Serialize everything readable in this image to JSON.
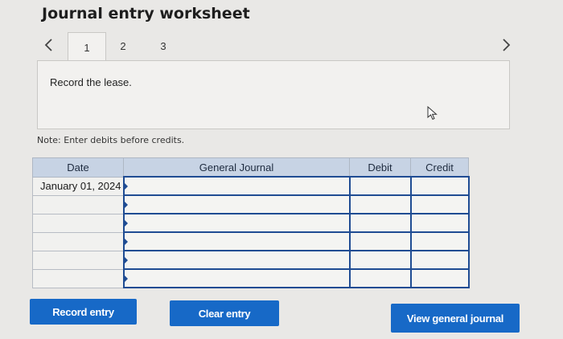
{
  "title": "Journal entry worksheet",
  "tabs": [
    {
      "label": "1",
      "active": true
    },
    {
      "label": "2",
      "active": false
    },
    {
      "label": "3",
      "active": false
    }
  ],
  "instruction": "Record the lease.",
  "note": "Note: Enter debits before credits.",
  "table": {
    "headers": {
      "date": "Date",
      "account": "General Journal",
      "debit": "Debit",
      "credit": "Credit"
    },
    "rows": [
      {
        "date": "January 01, 2024",
        "account": "",
        "debit": "",
        "credit": ""
      },
      {
        "date": "",
        "account": "",
        "debit": "",
        "credit": ""
      },
      {
        "date": "",
        "account": "",
        "debit": "",
        "credit": ""
      },
      {
        "date": "",
        "account": "",
        "debit": "",
        "credit": ""
      },
      {
        "date": "",
        "account": "",
        "debit": "",
        "credit": ""
      },
      {
        "date": "",
        "account": "",
        "debit": "",
        "credit": ""
      }
    ]
  },
  "buttons": {
    "record": "Record entry",
    "clear": "Clear entry",
    "view": "View general journal"
  },
  "icons": {
    "prev": "chevron-left-icon",
    "next": "chevron-right-icon",
    "cursor": "mouse-pointer-icon"
  },
  "colors": {
    "button": "#1769c7",
    "header": "#c7d3e4",
    "entry_border": "#1f4c93",
    "background": "#e9e8e6"
  }
}
